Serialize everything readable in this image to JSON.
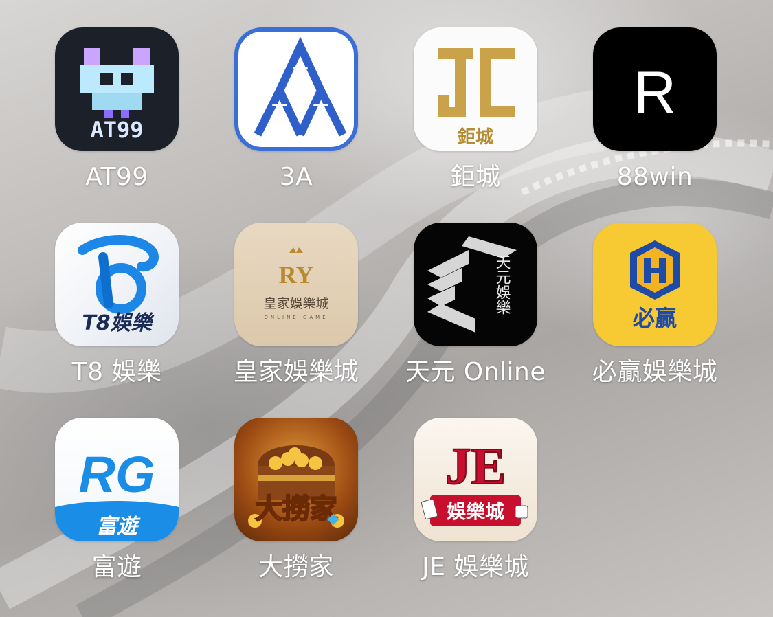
{
  "apps": [
    {
      "name": "AT99",
      "icon": "at99-icon",
      "icon_text": "AT99"
    },
    {
      "name": "3A",
      "icon": "3a-icon"
    },
    {
      "name": "鉅城",
      "icon": "jucheng-icon",
      "icon_text": "鉅城"
    },
    {
      "name": "88win",
      "icon": "88win-icon",
      "icon_text": "R"
    },
    {
      "name": "T8 娛樂",
      "icon": "t8-icon",
      "icon_text": "T8娛樂"
    },
    {
      "name": "皇家娛樂城",
      "icon": "royal-casino-icon",
      "icon_text": "皇家娛樂城",
      "icon_subtext": "ONLINE GAME",
      "icon_mark": "RY"
    },
    {
      "name": "天元 Online",
      "icon": "tianyuan-icon",
      "icon_text": "天元娛樂"
    },
    {
      "name": "必贏娛樂城",
      "icon": "biying-icon",
      "icon_text": "必贏"
    },
    {
      "name": "富遊",
      "icon": "rg-icon",
      "icon_text": "RG",
      "icon_subtext": "富遊"
    },
    {
      "name": "大撈家",
      "icon": "dalaojia-icon",
      "icon_text": "大撈家"
    },
    {
      "name": "JE 娛樂城",
      "icon": "je-icon",
      "icon_text": "JE",
      "icon_subtext": "娛樂城"
    }
  ],
  "colors": {
    "label": "#ffffff",
    "biying_bg": "#f7c933",
    "jucheng_gold": "#c9a24a",
    "je_red": "#c8102e"
  }
}
